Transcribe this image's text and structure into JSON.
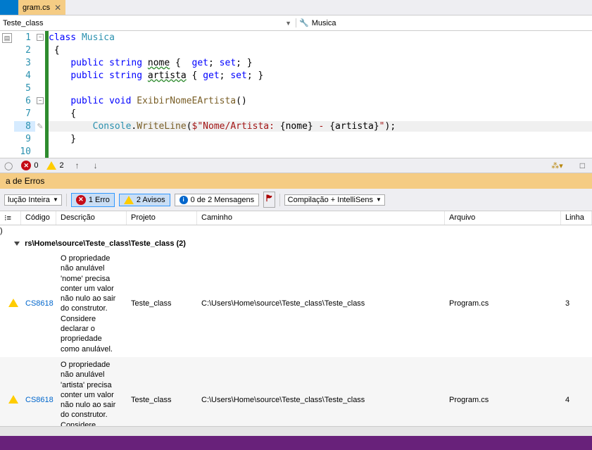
{
  "tab": {
    "filename": "gram.cs",
    "close": "✕"
  },
  "breadcrumb": {
    "left": "Teste_class",
    "right": "Musica"
  },
  "code": {
    "l1": "class Musica",
    "l2": "{",
    "l3a": "    public string ",
    "l3b": "nome",
    "l3c": " {  get; set; }",
    "l4a": "    public string ",
    "l4b": "artista",
    "l4c": " { get; set; }",
    "l5": "",
    "l6": "    public void ExibirNomeEArtista()",
    "l7": "    {",
    "l8a": "        Console.",
    "l8b": "WriteLine",
    "l8c": "($",
    "l8d": "\"Nome/Artista: {nome} - {artista}\"",
    "l8e": ");",
    "l9": "    }",
    "l10": ""
  },
  "statusbar": {
    "errors": "0",
    "warnings": "2"
  },
  "errlist": {
    "title": "a de Erros",
    "scope": "lução Inteira",
    "buttons": {
      "err": "1 Erro",
      "warn": "2 Avisos",
      "msg": "0 de 2 Mensagens",
      "build": "Compilação + IntelliSens"
    },
    "headers": {
      "code": "Código",
      "desc": "Descrição",
      "proj": "Projeto",
      "path": "Caminho",
      "file": "Arquivo",
      "line": "Linha"
    },
    "group": "rs\\Home\\source\\Teste_class\\Teste_class (2)",
    "rows": [
      {
        "code": "CS8618",
        "desc": "O propriedade não anulável 'nome' precisa conter um valor não nulo ao sair do construtor. Considere declarar o propriedade como anulável.",
        "proj": "Teste_class",
        "path": "C:\\Users\\Home\\source\\Teste_class\\Teste_class",
        "file": "Program.cs",
        "line": "3"
      },
      {
        "code": "CS8618",
        "desc": "O propriedade não anulável 'artista' precisa conter um valor não nulo ao sair do construtor. Considere declarar",
        "proj": "Teste_class",
        "path": "C:\\Users\\Home\\source\\Teste_class\\Teste_class",
        "file": "Program.cs",
        "line": "4"
      }
    ]
  }
}
